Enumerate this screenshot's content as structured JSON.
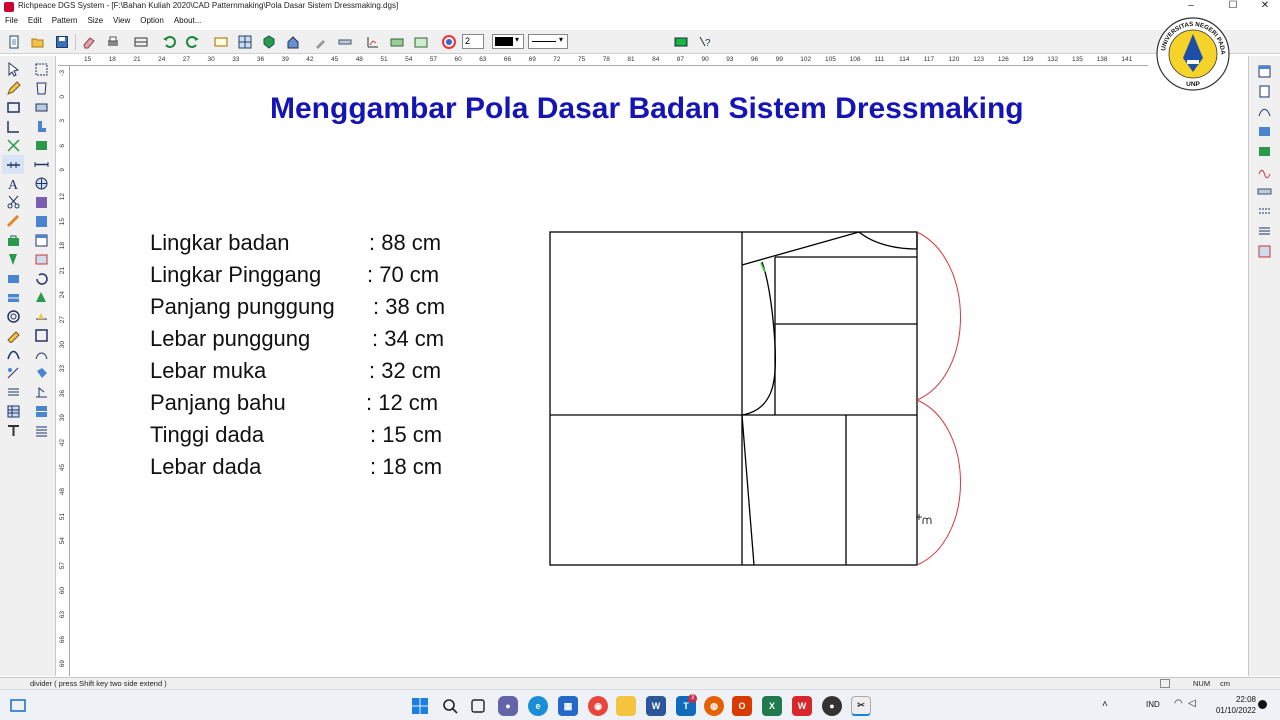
{
  "window": {
    "title": "Richpeace DGS System - [F:\\Bahan Kuliah 2020\\CAD Patternmaking\\Pola Dasar Sistem Dressmaking.dgs]",
    "min_glyph": "–",
    "max_glyph": "☐",
    "close_glyph": "✕"
  },
  "menu": [
    "File",
    "Edit",
    "Pattern",
    "Size",
    "View",
    "Option",
    "About..."
  ],
  "toolbar": {
    "line_width_value": "2"
  },
  "ruler": {
    "top_ticks": [
      "15",
      "18",
      "21",
      "24",
      "27",
      "30",
      "33",
      "36",
      "39",
      "42",
      "45",
      "48",
      "51",
      "54",
      "57",
      "60",
      "63",
      "66",
      "69",
      "72",
      "75",
      "78",
      "81",
      "84",
      "87",
      "90",
      "93",
      "96",
      "99",
      "102",
      "105",
      "108",
      "111",
      "114",
      "117",
      "120",
      "123",
      "126",
      "129",
      "132",
      "135",
      "138",
      "141"
    ],
    "left_ticks": [
      "-3",
      "0",
      "3",
      "6",
      "9",
      "12",
      "15",
      "18",
      "21",
      "24",
      "27",
      "30",
      "33",
      "36",
      "39",
      "42",
      "45",
      "48",
      "51",
      "54",
      "57",
      "60",
      "63",
      "66",
      "69"
    ]
  },
  "logo": {
    "text": "UNIVERSITAS NEGERI PADANG",
    "abbr": "UNP"
  },
  "slide": {
    "title": "Menggambar Pola Dasar Badan Sistem Dressmaking",
    "measurements": [
      {
        "label": "Lingkar badan",
        "value": ": 88 cm"
      },
      {
        "label": "Lingkar Pinggang",
        "value": ": 70 cm"
      },
      {
        "label": "Panjang punggung",
        "value": ": 38 cm"
      },
      {
        "label": "Lebar punggung",
        "value": ": 34 cm"
      },
      {
        "label": "Lebar muka",
        "value": ": 32 cm"
      },
      {
        "label": "Panjang bahu",
        "value": ": 12 cm"
      },
      {
        "label": "Tinggi dada",
        "value": ": 15 cm"
      },
      {
        "label": "Lebar dada",
        "value": ": 18 cm"
      }
    ]
  },
  "status": {
    "hint": "divider ( press Shift key two side extend )",
    "num": "NUM",
    "unit": "cm"
  },
  "taskbar": {
    "lang": "IND",
    "time": "22:08",
    "date": "01/10/2022",
    "teams_badge": "3"
  },
  "colors": {
    "title_blue": "#1515b5",
    "pattern_line": "#000000",
    "guide_curve": "#d9363e",
    "selection_green": "#2ecc40"
  }
}
